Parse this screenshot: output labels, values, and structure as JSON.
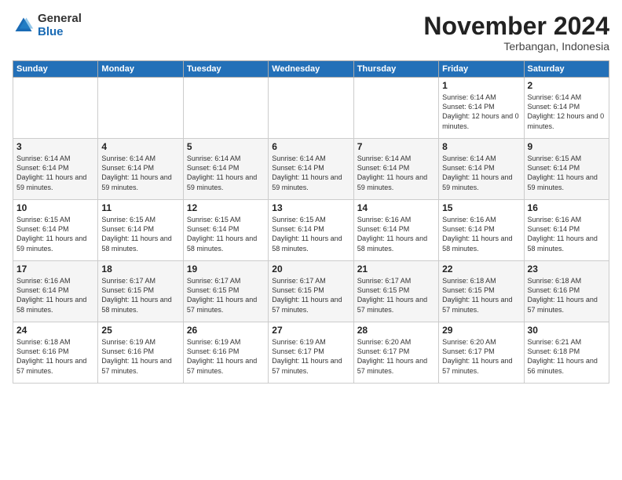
{
  "logo": {
    "general": "General",
    "blue": "Blue"
  },
  "title": "November 2024",
  "subtitle": "Terbangan, Indonesia",
  "days_of_week": [
    "Sunday",
    "Monday",
    "Tuesday",
    "Wednesday",
    "Thursday",
    "Friday",
    "Saturday"
  ],
  "weeks": [
    [
      {
        "day": "",
        "sunrise": "",
        "sunset": "",
        "daylight": ""
      },
      {
        "day": "",
        "sunrise": "",
        "sunset": "",
        "daylight": ""
      },
      {
        "day": "",
        "sunrise": "",
        "sunset": "",
        "daylight": ""
      },
      {
        "day": "",
        "sunrise": "",
        "sunset": "",
        "daylight": ""
      },
      {
        "day": "",
        "sunrise": "",
        "sunset": "",
        "daylight": ""
      },
      {
        "day": "1",
        "sunrise": "Sunrise: 6:14 AM",
        "sunset": "Sunset: 6:14 PM",
        "daylight": "Daylight: 12 hours and 0 minutes."
      },
      {
        "day": "2",
        "sunrise": "Sunrise: 6:14 AM",
        "sunset": "Sunset: 6:14 PM",
        "daylight": "Daylight: 12 hours and 0 minutes."
      }
    ],
    [
      {
        "day": "3",
        "sunrise": "Sunrise: 6:14 AM",
        "sunset": "Sunset: 6:14 PM",
        "daylight": "Daylight: 11 hours and 59 minutes."
      },
      {
        "day": "4",
        "sunrise": "Sunrise: 6:14 AM",
        "sunset": "Sunset: 6:14 PM",
        "daylight": "Daylight: 11 hours and 59 minutes."
      },
      {
        "day": "5",
        "sunrise": "Sunrise: 6:14 AM",
        "sunset": "Sunset: 6:14 PM",
        "daylight": "Daylight: 11 hours and 59 minutes."
      },
      {
        "day": "6",
        "sunrise": "Sunrise: 6:14 AM",
        "sunset": "Sunset: 6:14 PM",
        "daylight": "Daylight: 11 hours and 59 minutes."
      },
      {
        "day": "7",
        "sunrise": "Sunrise: 6:14 AM",
        "sunset": "Sunset: 6:14 PM",
        "daylight": "Daylight: 11 hours and 59 minutes."
      },
      {
        "day": "8",
        "sunrise": "Sunrise: 6:14 AM",
        "sunset": "Sunset: 6:14 PM",
        "daylight": "Daylight: 11 hours and 59 minutes."
      },
      {
        "day": "9",
        "sunrise": "Sunrise: 6:15 AM",
        "sunset": "Sunset: 6:14 PM",
        "daylight": "Daylight: 11 hours and 59 minutes."
      }
    ],
    [
      {
        "day": "10",
        "sunrise": "Sunrise: 6:15 AM",
        "sunset": "Sunset: 6:14 PM",
        "daylight": "Daylight: 11 hours and 59 minutes."
      },
      {
        "day": "11",
        "sunrise": "Sunrise: 6:15 AM",
        "sunset": "Sunset: 6:14 PM",
        "daylight": "Daylight: 11 hours and 58 minutes."
      },
      {
        "day": "12",
        "sunrise": "Sunrise: 6:15 AM",
        "sunset": "Sunset: 6:14 PM",
        "daylight": "Daylight: 11 hours and 58 minutes."
      },
      {
        "day": "13",
        "sunrise": "Sunrise: 6:15 AM",
        "sunset": "Sunset: 6:14 PM",
        "daylight": "Daylight: 11 hours and 58 minutes."
      },
      {
        "day": "14",
        "sunrise": "Sunrise: 6:16 AM",
        "sunset": "Sunset: 6:14 PM",
        "daylight": "Daylight: 11 hours and 58 minutes."
      },
      {
        "day": "15",
        "sunrise": "Sunrise: 6:16 AM",
        "sunset": "Sunset: 6:14 PM",
        "daylight": "Daylight: 11 hours and 58 minutes."
      },
      {
        "day": "16",
        "sunrise": "Sunrise: 6:16 AM",
        "sunset": "Sunset: 6:14 PM",
        "daylight": "Daylight: 11 hours and 58 minutes."
      }
    ],
    [
      {
        "day": "17",
        "sunrise": "Sunrise: 6:16 AM",
        "sunset": "Sunset: 6:14 PM",
        "daylight": "Daylight: 11 hours and 58 minutes."
      },
      {
        "day": "18",
        "sunrise": "Sunrise: 6:17 AM",
        "sunset": "Sunset: 6:15 PM",
        "daylight": "Daylight: 11 hours and 58 minutes."
      },
      {
        "day": "19",
        "sunrise": "Sunrise: 6:17 AM",
        "sunset": "Sunset: 6:15 PM",
        "daylight": "Daylight: 11 hours and 57 minutes."
      },
      {
        "day": "20",
        "sunrise": "Sunrise: 6:17 AM",
        "sunset": "Sunset: 6:15 PM",
        "daylight": "Daylight: 11 hours and 57 minutes."
      },
      {
        "day": "21",
        "sunrise": "Sunrise: 6:17 AM",
        "sunset": "Sunset: 6:15 PM",
        "daylight": "Daylight: 11 hours and 57 minutes."
      },
      {
        "day": "22",
        "sunrise": "Sunrise: 6:18 AM",
        "sunset": "Sunset: 6:15 PM",
        "daylight": "Daylight: 11 hours and 57 minutes."
      },
      {
        "day": "23",
        "sunrise": "Sunrise: 6:18 AM",
        "sunset": "Sunset: 6:16 PM",
        "daylight": "Daylight: 11 hours and 57 minutes."
      }
    ],
    [
      {
        "day": "24",
        "sunrise": "Sunrise: 6:18 AM",
        "sunset": "Sunset: 6:16 PM",
        "daylight": "Daylight: 11 hours and 57 minutes."
      },
      {
        "day": "25",
        "sunrise": "Sunrise: 6:19 AM",
        "sunset": "Sunset: 6:16 PM",
        "daylight": "Daylight: 11 hours and 57 minutes."
      },
      {
        "day": "26",
        "sunrise": "Sunrise: 6:19 AM",
        "sunset": "Sunset: 6:16 PM",
        "daylight": "Daylight: 11 hours and 57 minutes."
      },
      {
        "day": "27",
        "sunrise": "Sunrise: 6:19 AM",
        "sunset": "Sunset: 6:17 PM",
        "daylight": "Daylight: 11 hours and 57 minutes."
      },
      {
        "day": "28",
        "sunrise": "Sunrise: 6:20 AM",
        "sunset": "Sunset: 6:17 PM",
        "daylight": "Daylight: 11 hours and 57 minutes."
      },
      {
        "day": "29",
        "sunrise": "Sunrise: 6:20 AM",
        "sunset": "Sunset: 6:17 PM",
        "daylight": "Daylight: 11 hours and 57 minutes."
      },
      {
        "day": "30",
        "sunrise": "Sunrise: 6:21 AM",
        "sunset": "Sunset: 6:18 PM",
        "daylight": "Daylight: 11 hours and 56 minutes."
      }
    ]
  ]
}
